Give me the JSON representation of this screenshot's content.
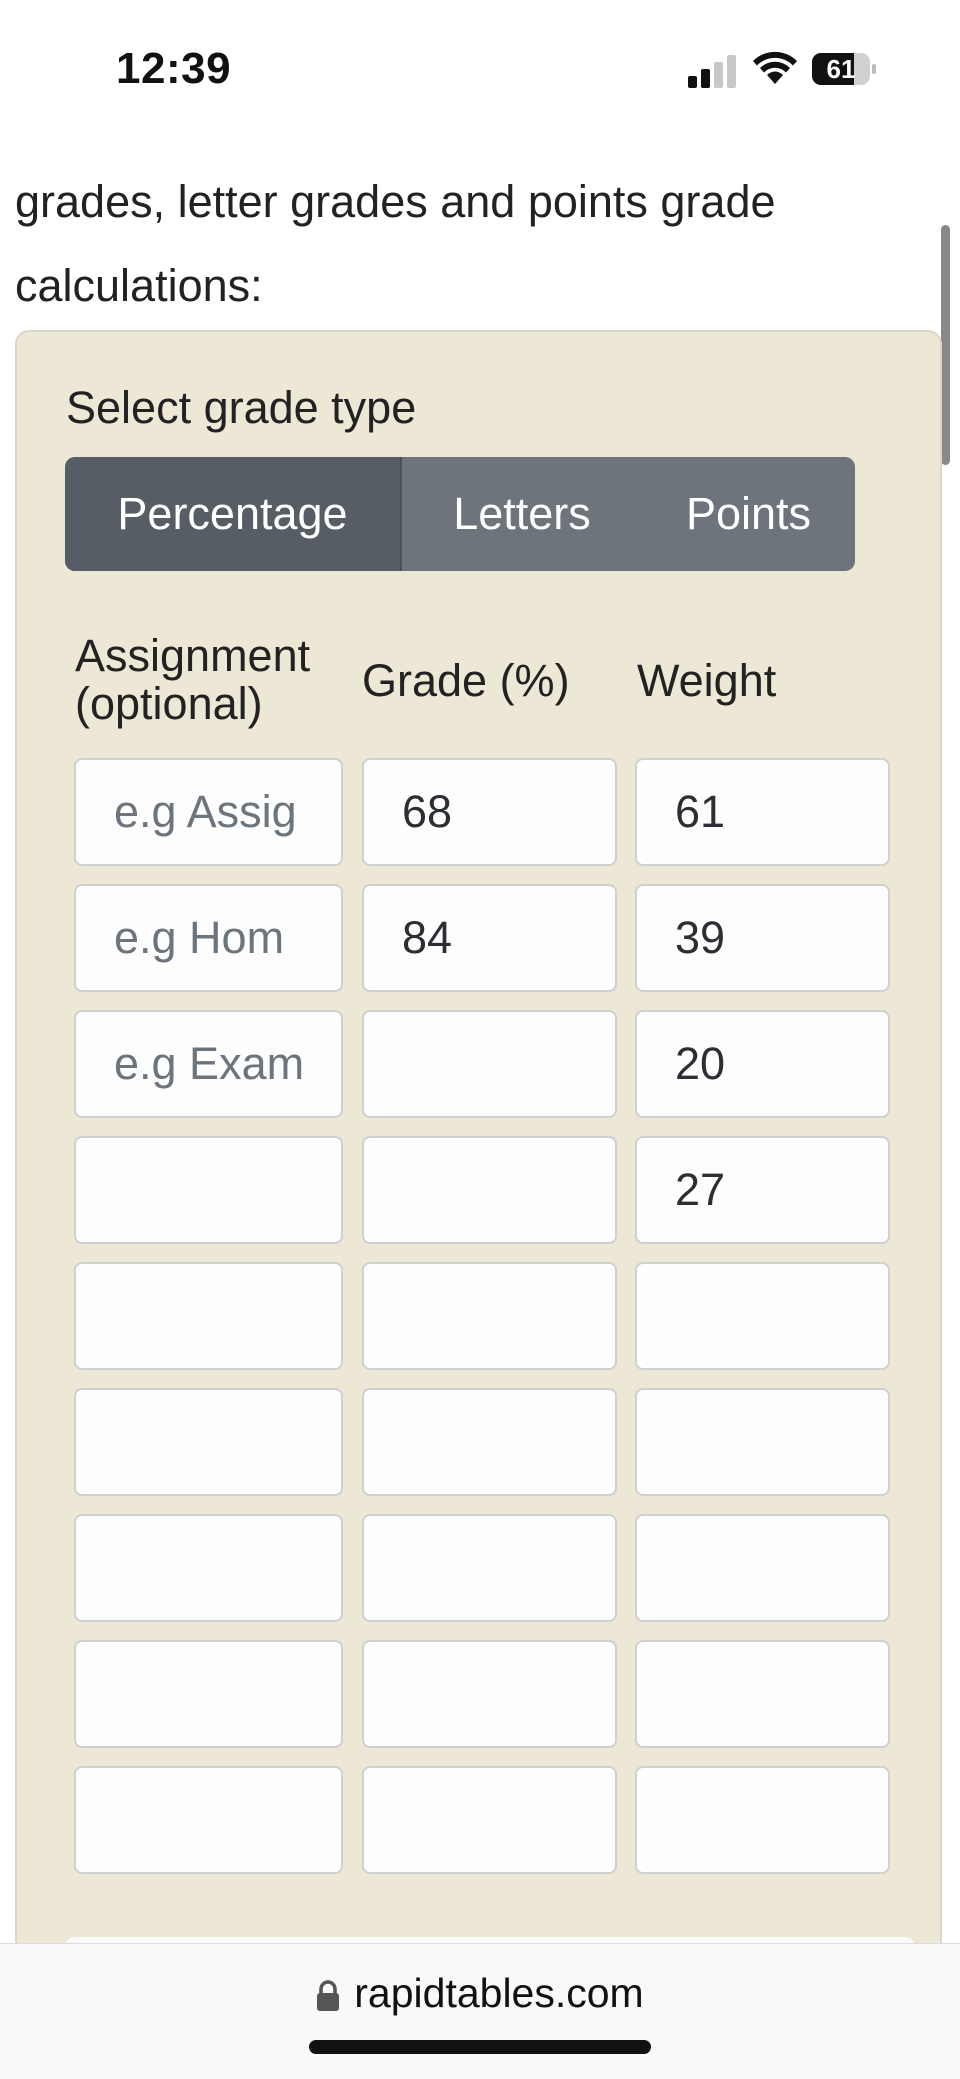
{
  "status_bar": {
    "time": "12:39",
    "battery": "61"
  },
  "intro_text": "grades, letter grades and points grade calculations:",
  "calculator": {
    "select_label": "Select grade type",
    "grade_types": [
      "Percentage",
      "Letters",
      "Points"
    ],
    "selected_type": "Percentage",
    "headers": {
      "assignment": "Assignment (optional)",
      "grade": "Grade (%)",
      "weight": "Weight"
    },
    "rows": [
      {
        "assignment": "",
        "assignment_placeholder": "e.g Assig",
        "grade": "68",
        "weight": "61"
      },
      {
        "assignment": "",
        "assignment_placeholder": "e.g Hom",
        "grade": "84",
        "weight": "39"
      },
      {
        "assignment": "",
        "assignment_placeholder": "e.g Exam",
        "grade": "",
        "weight": "20"
      },
      {
        "assignment": "",
        "assignment_placeholder": "",
        "grade": "",
        "weight": "27"
      },
      {
        "assignment": "",
        "assignment_placeholder": "",
        "grade": "",
        "weight": ""
      },
      {
        "assignment": "",
        "assignment_placeholder": "",
        "grade": "",
        "weight": ""
      },
      {
        "assignment": "",
        "assignment_placeholder": "",
        "grade": "",
        "weight": ""
      },
      {
        "assignment": "",
        "assignment_placeholder": "",
        "grade": "",
        "weight": ""
      },
      {
        "assignment": "",
        "assignment_placeholder": "",
        "grade": "",
        "weight": ""
      }
    ]
  },
  "browser": {
    "url": "rapidtables.com",
    "lock_icon": "lock-icon"
  },
  "colors": {
    "panel_bg": "#ede7d6",
    "button_active": "#565d64",
    "button_default": "#6d747c",
    "placeholder_text": "#6c757d"
  }
}
